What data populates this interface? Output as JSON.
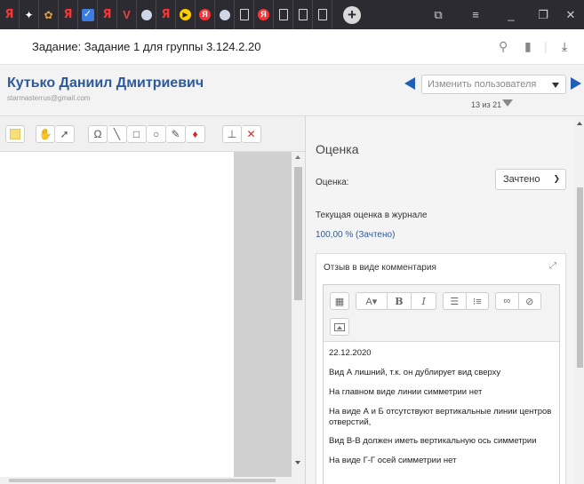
{
  "browser": {
    "tabs": [
      {
        "icon": "yandex-icon",
        "glyph": "Я"
      },
      {
        "icon": "star-icon",
        "glyph": "✦"
      },
      {
        "icon": "bug-icon",
        "glyph": "✿"
      },
      {
        "icon": "yandex-icon",
        "glyph": "Я"
      },
      {
        "icon": "checkbox-icon",
        "glyph": "✓"
      },
      {
        "icon": "yandex-icon",
        "glyph": "Я"
      },
      {
        "icon": "v-icon",
        "glyph": "V"
      },
      {
        "icon": "circle-icon",
        "glyph": ""
      },
      {
        "icon": "yandex-icon",
        "glyph": "Я"
      },
      {
        "icon": "play-icon",
        "glyph": "▶"
      },
      {
        "icon": "yandex-round-icon",
        "glyph": "Я"
      },
      {
        "icon": "circle-icon",
        "glyph": ""
      },
      {
        "icon": "document-icon",
        "glyph": ""
      },
      {
        "icon": "yandex-round-icon",
        "glyph": "Я"
      },
      {
        "icon": "document-icon",
        "glyph": ""
      },
      {
        "icon": "document-icon",
        "glyph": ""
      },
      {
        "icon": "document-icon",
        "glyph": ""
      }
    ],
    "new_tab": "+",
    "page_title": "Задание: Задание 1 для группы 3.124.2.20"
  },
  "header": {
    "user_name": "Кутько Даниил Дмитриевич",
    "user_email": "starmasterrus@gmail.com",
    "change_user_placeholder": "Изменить пользователя",
    "user_count": "13 из 21"
  },
  "panel": {
    "title": "Оценка",
    "grade_label": "Оценка:",
    "grade_value": "Зачтено",
    "current_grade_label": "Текущая оценка в журнале",
    "current_grade_value": "100,00 % (Зачтено)",
    "feedback_title": "Отзыв в виде комментария",
    "feedback_lines": [
      "22.12.2020",
      "Вид А лишний, т.к. он дублирует вид сверху",
      "На главном виде линии симметрии нет",
      "На виде А и Б отсутствуют вертикальные линии центров отверстий,",
      "Вид В-В должен иметь вертикальную ось симметрии",
      "На виде Г-Г осей симметрии нет"
    ]
  },
  "colors": {
    "link_blue": "#2c5a9a",
    "nav_arrow": "#1f5fb5",
    "tabstrip_bg": "#2b2b31"
  }
}
